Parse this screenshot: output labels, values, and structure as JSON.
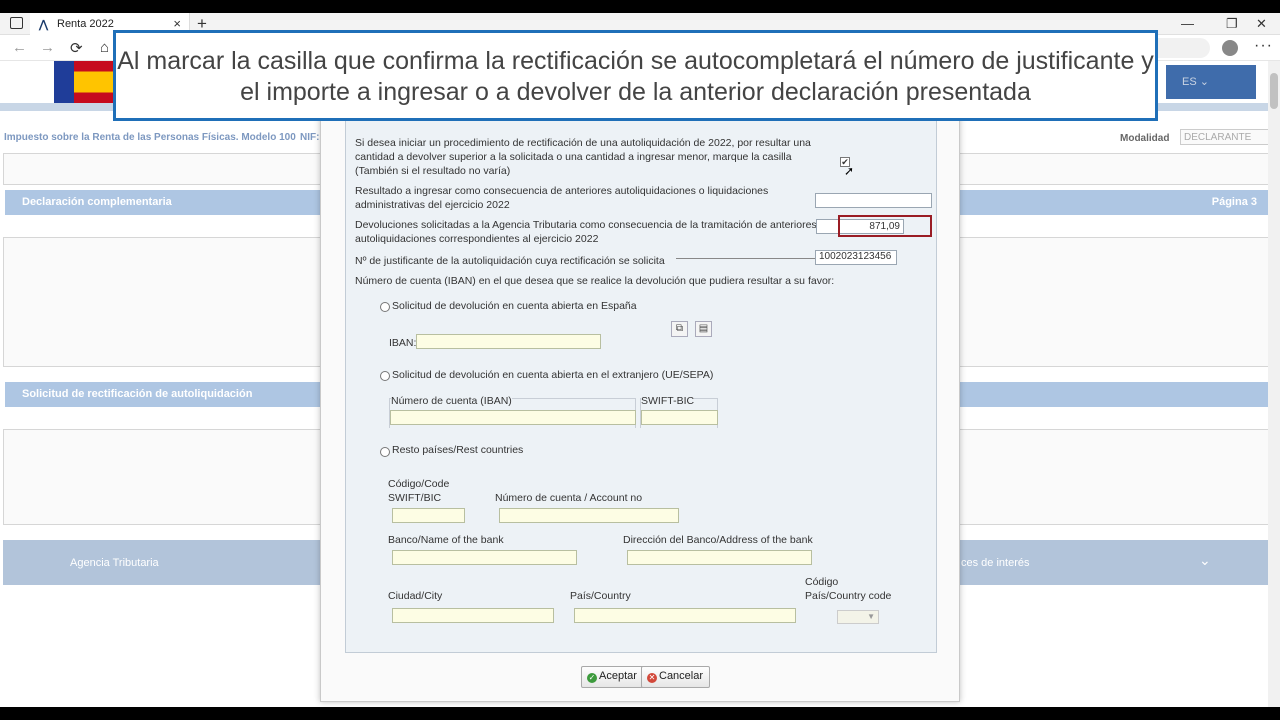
{
  "browser": {
    "tab_title": "Renta 2022",
    "tab_close": "×",
    "new_tab": "+",
    "window_controls": [
      "—",
      "❐",
      "✕"
    ],
    "nav_icons": [
      "←",
      "→",
      "⟳",
      "⌂"
    ],
    "more": "···"
  },
  "page": {
    "lang": "ES",
    "breadcrumb": "Impuesto sobre la Renta de las Personas Físicas. Modelo 100",
    "nif_label": "NIF:",
    "modalidad_label": "Modalidad",
    "modalidad_value": "DECLARANTE",
    "section1": "Declaración complementaria",
    "page_label": "Página 3",
    "section2": "Solicitud de rectificación de autoliquidación",
    "footer_left": "Agencia Tributaria",
    "footer_right": "ces de interés"
  },
  "modal": {
    "intro": [
      "Si desea iniciar un procedimiento de rectificación de una autoliquidación de 2022, por resultar una",
      "cantidad a devolver superior a la solicitada o una cantidad a ingresar menor, marque la casilla",
      "(También si el resultado no varía)"
    ],
    "checkbox_mark": "✔",
    "resultado_label": [
      "Resultado a ingresar como consecuencia de anteriores autoliquidaciones o liquidaciones",
      "administrativas del ejercicio 2022"
    ],
    "resultado_value": "",
    "devoluciones_label": [
      "Devoluciones solicitadas a la Agencia Tributaria como consecuencia de la tramitación de anteriores",
      "autoliquidaciones correspondientes al ejercicio 2022"
    ],
    "devoluciones_value": "871,09",
    "justificante_label": "Nº de justificante de la autoliquidación cuya rectificación se solicita",
    "justificante_value": "1002023123456",
    "cuenta_label": "Número de cuenta (IBAN) en el que desea que se realice la devolución que pudiera resultar a su favor:",
    "opt_espana": "Solicitud de devolución en cuenta abierta en España",
    "iban_label": "IBAN:",
    "opt_extranjero": "Solicitud de devolución en cuenta abierta en el extranjero (UE/SEPA)",
    "num_cuenta_iban": "Número de cuenta (IBAN)",
    "swift_bic": "SWIFT-BIC",
    "opt_resto": "Resto países/Rest countries",
    "codigo_code": "Código/Code",
    "swift_bic2": "SWIFT/BIC",
    "num_cuenta_account": "Número de cuenta / Account no",
    "banco": "Banco/Name of the bank",
    "direccion": "Dirección del Banco/Address of the bank",
    "ciudad": "Ciudad/City",
    "pais": "País/Country",
    "codigo_pais": [
      "Código",
      "País/Country code"
    ],
    "aceptar": "Aceptar",
    "cancelar": "Cancelar",
    "copy_icon": "⧉",
    "paste_icon": "📋"
  },
  "caption": [
    "Al marcar la casilla que confirma la rectificación se autocompletará el número de justificante y",
    "el importe a ingresar o a devolver de la anterior declaración presentada"
  ],
  "colors": {
    "caption_border": "#1f6fb8",
    "section_bar": "#aec6e3",
    "highlight": "#9a1c24",
    "panel": "#edf2f6"
  }
}
